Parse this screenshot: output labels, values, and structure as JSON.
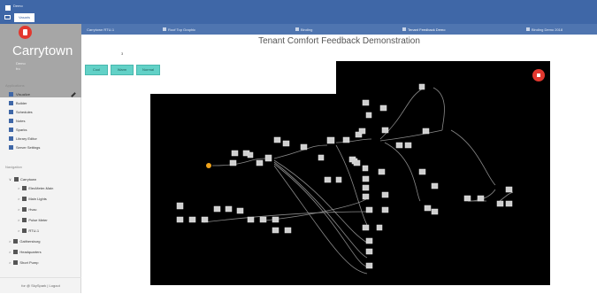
{
  "topbar": {
    "app_name": "Demo",
    "tab_label": "Vasaris"
  },
  "sidebar": {
    "site_title": "Carrytown",
    "user_line1": "Demo",
    "user_line2": "fro",
    "applications_heading": "Applications",
    "applications": [
      {
        "label": "Visualize",
        "icon": "visualize-icon"
      },
      {
        "label": "Builder",
        "icon": "builder-icon"
      },
      {
        "label": "Schedules",
        "icon": "schedules-icon"
      },
      {
        "label": "Notes",
        "icon": "notes-icon"
      },
      {
        "label": "Sparks",
        "icon": "sparks-icon"
      },
      {
        "label": "Library Editor",
        "icon": "library-icon"
      },
      {
        "label": "Server Settings",
        "icon": "settings-icon"
      }
    ],
    "navigation_heading": "Navigation",
    "nav_tree": [
      {
        "label": "Carrytown",
        "level": 0,
        "expanded": true
      },
      {
        "label": "ElecMeter-Main",
        "level": 1
      },
      {
        "label": "Main Lights",
        "level": 1
      },
      {
        "label": "Hvac",
        "level": 1
      },
      {
        "label": "Pulse Meter",
        "level": 1
      },
      {
        "label": "RTU-1",
        "level": 1
      },
      {
        "label": "Gaithersburg",
        "level": 0
      },
      {
        "label": "Headquarters",
        "level": 0
      },
      {
        "label": "Short Pump",
        "level": 0
      }
    ],
    "footer": "for @ SkySpark | Logout"
  },
  "main": {
    "tabs": [
      {
        "label": "Carrytown RTU-1",
        "active": false
      },
      {
        "label": "Roof Top Graphic",
        "active": false
      },
      {
        "label": "Binding",
        "active": false
      },
      {
        "label": "Tenant Feedback Demo",
        "active": true
      },
      {
        "label": "Binding Demo 2018",
        "active": false
      }
    ],
    "page_title": "Tenant Comfort Feedback Demonstration",
    "counter": "3",
    "buttons": {
      "cool": "Cool",
      "warm": "Warm",
      "normal": "Normal"
    }
  },
  "colors": {
    "brand_blue": "#3f67a7",
    "accent_red": "#e2382f",
    "action_teal": "#62d1c7"
  }
}
